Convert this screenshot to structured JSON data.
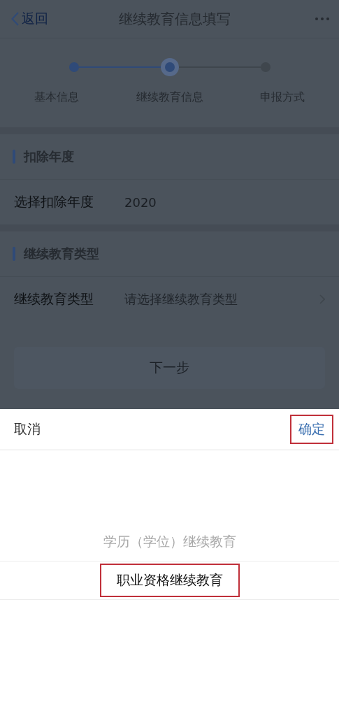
{
  "nav_bar": {
    "back_label": "返回",
    "title": "继续教育信息填写"
  },
  "steps": [
    {
      "label": "基本信息",
      "completed": true,
      "selected": false
    },
    {
      "label": "继续教育信息",
      "completed": false,
      "selected": true
    },
    {
      "label": "申报方式",
      "completed": false,
      "selected": false
    }
  ],
  "sections": [
    {
      "heading": "扣除年度",
      "field": {
        "label": "选择扣除年度",
        "value": "2020",
        "kind": "value"
      }
    },
    {
      "heading": "继续教育类型",
      "field": {
        "label": "继续教育类型",
        "placeholder": "请选择继续教育类型",
        "kind": "select"
      }
    }
  ],
  "next_button": {
    "label": "下一步",
    "disabled": true
  },
  "picker": {
    "cancel_label": "取消",
    "confirm_label": "确定",
    "confirm_annotated": true,
    "options": [
      {
        "label": "学历（学位）继续教育",
        "selected": false,
        "annotated": false
      },
      {
        "label": "职业资格继续教育",
        "selected": true,
        "annotated": true
      }
    ]
  }
}
